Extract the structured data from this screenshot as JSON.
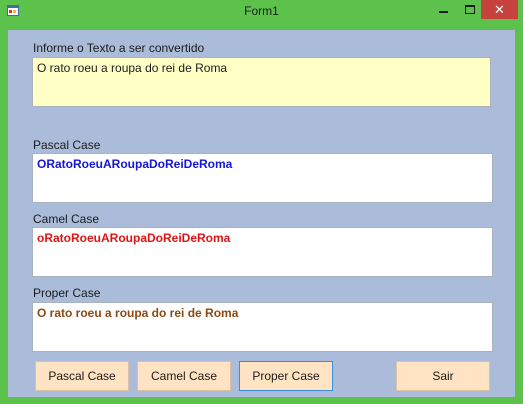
{
  "window": {
    "title": "Form1",
    "controls": {
      "minimize": "minimize",
      "maximize": "maximize",
      "close": "✕"
    }
  },
  "input": {
    "label": "Informe o Texto a ser convertido",
    "value": "O rato roeu a roupa do rei de Roma"
  },
  "outputs": {
    "pascal": {
      "label": "Pascal Case",
      "value": "ORatoRoeuARoupaDoReiDeRoma"
    },
    "camel": {
      "label": "Camel Case",
      "value": "oRatoRoeuARoupaDoReiDeRoma"
    },
    "proper": {
      "label": "Proper Case",
      "value": "O rato roeu a roupa do rei de Roma"
    }
  },
  "buttons": {
    "pascal": "Pascal Case",
    "camel": "Camel Case",
    "proper": "Proper Case",
    "exit": "Sair"
  },
  "colors": {
    "titlebar": "#5cc24c",
    "client": "#aabcda",
    "input_bg": "#ffffc6",
    "pascal_text": "#1515d6",
    "camel_text": "#e01414",
    "proper_text": "#8a4a10",
    "button_bg": "#ffe3c2"
  }
}
